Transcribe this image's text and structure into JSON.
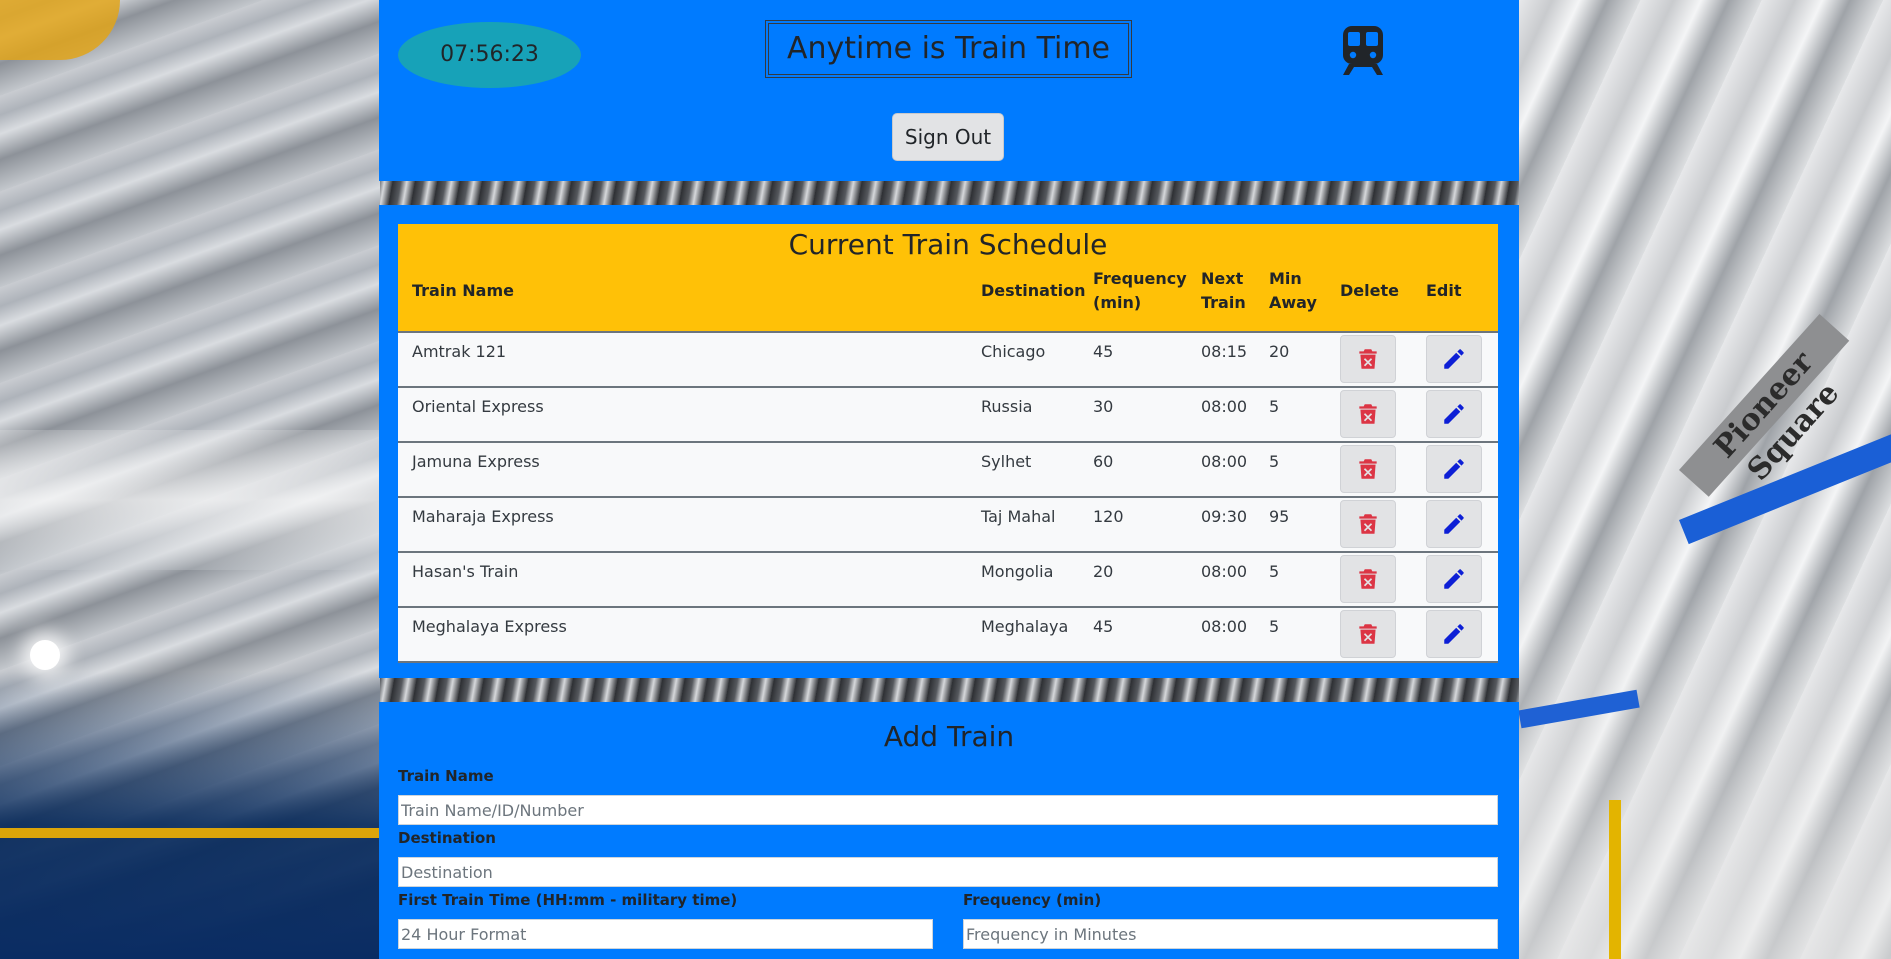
{
  "header": {
    "clock": "07:56:23",
    "title": "Anytime is Train Time",
    "sign_out_label": "Sign Out"
  },
  "schedule": {
    "caption": "Current Train Schedule",
    "columns": {
      "name": "Train Name",
      "destination": "Destination",
      "frequency_line1": "Frequency",
      "frequency_line2": "(min)",
      "next_line1": "Next",
      "next_line2": "Train",
      "away_line1": "Min",
      "away_line2": "Away",
      "delete": "Delete",
      "edit": "Edit"
    },
    "rows": [
      {
        "name": "Amtrak 121",
        "destination": "Chicago",
        "frequency": "45",
        "next": "08:15",
        "away": "20"
      },
      {
        "name": "Oriental Express",
        "destination": "Russia",
        "frequency": "30",
        "next": "08:00",
        "away": "5"
      },
      {
        "name": "Jamuna Express",
        "destination": "Sylhet",
        "frequency": "60",
        "next": "08:00",
        "away": "5"
      },
      {
        "name": "Maharaja Express",
        "destination": "Taj Mahal",
        "frequency": "120",
        "next": "09:30",
        "away": "95"
      },
      {
        "name": "Hasan's Train",
        "destination": "Mongolia",
        "frequency": "20",
        "next": "08:00",
        "away": "5"
      },
      {
        "name": "Meghalaya Express",
        "destination": "Meghalaya",
        "frequency": "45",
        "next": "08:00",
        "away": "5"
      }
    ]
  },
  "add_train": {
    "title": "Add Train",
    "name_label": "Train Name",
    "name_placeholder": "Train Name/ID/Number",
    "destination_label": "Destination",
    "destination_placeholder": "Destination",
    "first_time_label": "First Train Time (HH:mm - military time)",
    "first_time_placeholder": "24 Hour Format",
    "frequency_label": "Frequency (min)",
    "frequency_placeholder": "Frequency in Minutes"
  },
  "background": {
    "station_sign": "Pioneer Square"
  },
  "colors": {
    "panel": "#007bff",
    "clock": "#17a2b8",
    "table_header": "#ffc107",
    "delete_icon": "#dc3545",
    "edit_icon": "#0d1fd6"
  },
  "icons": {
    "header": "train-icon",
    "delete": "trash-icon",
    "edit": "pencil-icon"
  }
}
